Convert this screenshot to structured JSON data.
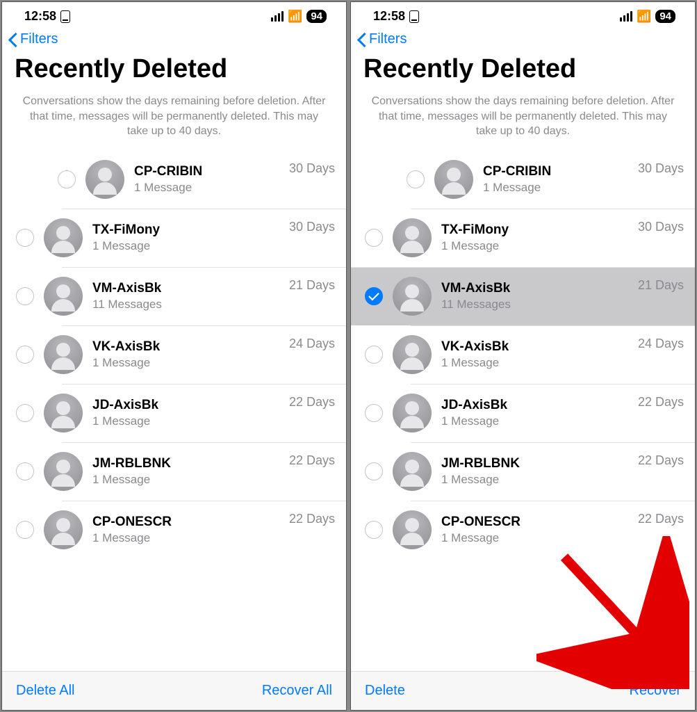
{
  "status": {
    "time": "12:58",
    "battery": "94"
  },
  "nav": {
    "back_label": "Filters"
  },
  "page": {
    "title": "Recently Deleted",
    "subtitle": "Conversations show the days remaining before deletion. After that time, messages will be permanently deleted. This may take up to 40 days."
  },
  "screens": [
    {
      "toolbar": {
        "left": "Delete All",
        "right": "Recover All"
      },
      "rows": [
        {
          "checked": false,
          "title": "CP-CRIBIN",
          "sub": "1 Message",
          "days": "30 Days"
        },
        {
          "checked": false,
          "title": "TX-FiMony",
          "sub": "1 Message",
          "days": "30 Days"
        },
        {
          "checked": false,
          "title": "VM-AxisBk",
          "sub": "11 Messages",
          "days": "21 Days"
        },
        {
          "checked": false,
          "title": "VK-AxisBk",
          "sub": "1 Message",
          "days": "24 Days"
        },
        {
          "checked": false,
          "title": "JD-AxisBk",
          "sub": "1 Message",
          "days": "22 Days"
        },
        {
          "checked": false,
          "title": "JM-RBLBNK",
          "sub": "1 Message",
          "days": "22 Days"
        },
        {
          "checked": false,
          "title": "CP-ONESCR",
          "sub": "1 Message",
          "days": "22 Days"
        }
      ]
    },
    {
      "toolbar": {
        "left": "Delete",
        "right": "Recover"
      },
      "rows": [
        {
          "checked": false,
          "title": "CP-CRIBIN",
          "sub": "1 Message",
          "days": "30 Days"
        },
        {
          "checked": false,
          "title": "TX-FiMony",
          "sub": "1 Message",
          "days": "30 Days"
        },
        {
          "checked": true,
          "title": "VM-AxisBk",
          "sub": "11 Messages",
          "days": "21 Days"
        },
        {
          "checked": false,
          "title": "VK-AxisBk",
          "sub": "1 Message",
          "days": "24 Days"
        },
        {
          "checked": false,
          "title": "JD-AxisBk",
          "sub": "1 Message",
          "days": "22 Days"
        },
        {
          "checked": false,
          "title": "JM-RBLBNK",
          "sub": "1 Message",
          "days": "22 Days"
        },
        {
          "checked": false,
          "title": "CP-ONESCR",
          "sub": "1 Message",
          "days": "22 Days"
        }
      ]
    }
  ]
}
